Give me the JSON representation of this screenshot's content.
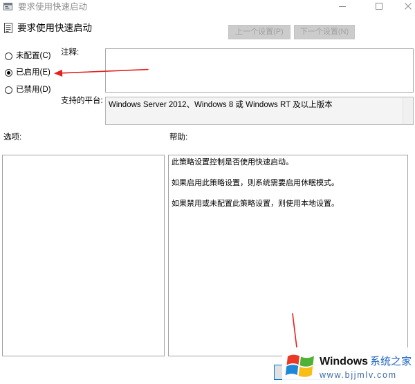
{
  "window": {
    "title": "要求使用快速启动"
  },
  "header": {
    "policy_name": "要求使用快速启动",
    "prev_button": "上一个设置(P)",
    "next_button": "下一个设置(N)",
    "nav_buttons_enabled": false
  },
  "state": {
    "options": [
      {
        "label": "未配置(C)",
        "selected": false
      },
      {
        "label": "已启用(E)",
        "selected": true
      },
      {
        "label": "已禁用(D)",
        "selected": false
      }
    ]
  },
  "comment": {
    "label": "注释:",
    "value": ""
  },
  "platform": {
    "label": "支持的平台:",
    "value": "Windows Server 2012、Windows 8 或 Windows RT 及以上版本"
  },
  "options_pane": {
    "label": "选项:"
  },
  "help_pane": {
    "label": "帮助:",
    "paragraphs": [
      "此策略设置控制是否使用快速启动。",
      "如果启用此策略设置，则系统需要启用休眠模式。",
      "如果禁用或未配置此策略设置，则使用本地设置。"
    ]
  },
  "watermark": {
    "brand": "Windows",
    "brand_cn": "系统之家",
    "url": "www.bjjmlv.com"
  },
  "icons": {
    "app": "group-policy-icon",
    "policy": "policy-setting-icon",
    "minimize": "minimize-icon",
    "maximize": "maximize-icon",
    "close": "close-icon",
    "logo": "windows-flag-logo"
  },
  "colors": {
    "annotation": "#e3211d",
    "brand_blue": "#2066c4",
    "url_blue": "#3a6ca8",
    "flag_red": "#ea3a27",
    "flag_green": "#4fb135",
    "flag_blue": "#1e88d8",
    "flag_yellow": "#f8bd16"
  }
}
